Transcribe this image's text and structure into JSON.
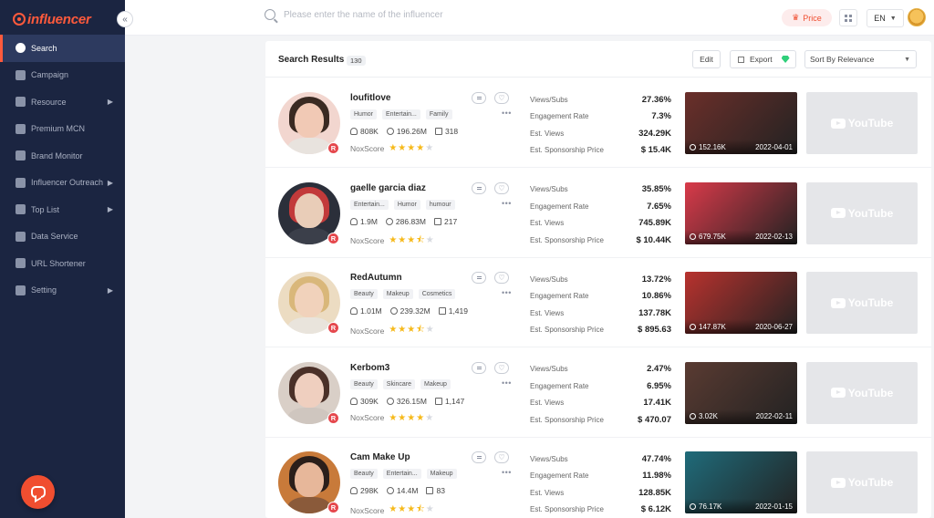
{
  "app": {
    "logo_text": "influencer"
  },
  "sidebar": {
    "items": [
      {
        "label": "Search",
        "active": true,
        "arrow": false
      },
      {
        "label": "Campaign",
        "active": false,
        "arrow": false
      },
      {
        "label": "Resource",
        "active": false,
        "arrow": true
      },
      {
        "label": "Premium MCN",
        "active": false,
        "arrow": false
      },
      {
        "label": "Brand Monitor",
        "active": false,
        "arrow": false
      },
      {
        "label": "Influencer Outreach",
        "active": false,
        "arrow": true
      },
      {
        "label": "Top List",
        "active": false,
        "arrow": true
      },
      {
        "label": "Data Service",
        "active": false,
        "arrow": false
      },
      {
        "label": "URL Shortener",
        "active": false,
        "arrow": false
      },
      {
        "label": "Setting",
        "active": false,
        "arrow": true
      }
    ]
  },
  "topbar": {
    "search_placeholder": "Please enter the name of the influencer",
    "price_label": "Price",
    "lang_label": "EN"
  },
  "results": {
    "title": "Search Results",
    "count": "130",
    "edit_label": "Edit",
    "export_label": "Export",
    "sort_label": "Sort By Relevance"
  },
  "labels": {
    "noxscore": "NoxScore",
    "views_subs": "Views/Subs",
    "engagement": "Engagement Rate",
    "est_views": "Est. Views",
    "sponsorship": "Est. Sponsorship Price",
    "youtube": "YouTube"
  },
  "influencers": [
    {
      "name": "loufitlove",
      "tags": [
        "Humor",
        "Entertain...",
        "Family"
      ],
      "subs": "808K",
      "views": "196.26M",
      "videos": "318",
      "stars": 4,
      "views_subs": "27.36%",
      "engagement": "7.3%",
      "est_views": "324.29K",
      "sponsorship": "$ 15.4K",
      "thumb_views": "152.16K",
      "thumb_date": "2022-04-01",
      "colors": {
        "bg": "#f2d6cf",
        "hair": "#3a2a22",
        "face": "#f1c9b5",
        "body": "#e8e3de",
        "thumb": "#6b2f2a"
      }
    },
    {
      "name": "gaelle garcia diaz",
      "tags": [
        "Entertain...",
        "Humor",
        "humour"
      ],
      "subs": "1.9M",
      "views": "286.83M",
      "videos": "217",
      "stars": 3.5,
      "views_subs": "35.85%",
      "engagement": "7.65%",
      "est_views": "745.89K",
      "sponsorship": "$ 10.44K",
      "thumb_views": "679.75K",
      "thumb_date": "2022-02-13",
      "colors": {
        "bg": "#2b2f3a",
        "hair": "#c23a3a",
        "face": "#e9cdb8",
        "body": "#3b3f4a",
        "thumb": "#d93a4a"
      }
    },
    {
      "name": "RedAutumn",
      "tags": [
        "Beauty",
        "Makeup",
        "Cosmetics"
      ],
      "subs": "1.01M",
      "views": "239.32M",
      "videos": "1,419",
      "stars": 3.5,
      "views_subs": "13.72%",
      "engagement": "10.86%",
      "est_views": "137.78K",
      "sponsorship": "$ 895.63",
      "thumb_views": "147.87K",
      "thumb_date": "2020-06-27",
      "colors": {
        "bg": "#ecdcc2",
        "hair": "#d9b77a",
        "face": "#f1d2bb",
        "body": "#e9e4dc",
        "thumb": "#b8322e"
      }
    },
    {
      "name": "Kerbom3",
      "tags": [
        "Beauty",
        "Skincare",
        "Makeup"
      ],
      "subs": "309K",
      "views": "326.15M",
      "videos": "1,147",
      "stars": 4,
      "views_subs": "2.47%",
      "engagement": "6.95%",
      "est_views": "17.41K",
      "sponsorship": "$ 470.07",
      "thumb_views": "3.02K",
      "thumb_date": "2022-02-11",
      "colors": {
        "bg": "#d9cfc7",
        "hair": "#4a3028",
        "face": "#efcfbf",
        "body": "#cfc6bf",
        "thumb": "#5a3b32"
      }
    },
    {
      "name": "Cam Make Up",
      "tags": [
        "Beauty",
        "Entertain...",
        "Makeup"
      ],
      "subs": "298K",
      "views": "14.4M",
      "videos": "83",
      "stars": 3.5,
      "views_subs": "47.74%",
      "engagement": "11.98%",
      "est_views": "128.85K",
      "sponsorship": "$ 6.12K",
      "thumb_views": "76.17K",
      "thumb_date": "2022-01-15",
      "colors": {
        "bg": "#c87a3a",
        "hair": "#2a1e1a",
        "face": "#e7b79a",
        "body": "#8a5a3a",
        "thumb": "#1f6b7a"
      }
    }
  ]
}
